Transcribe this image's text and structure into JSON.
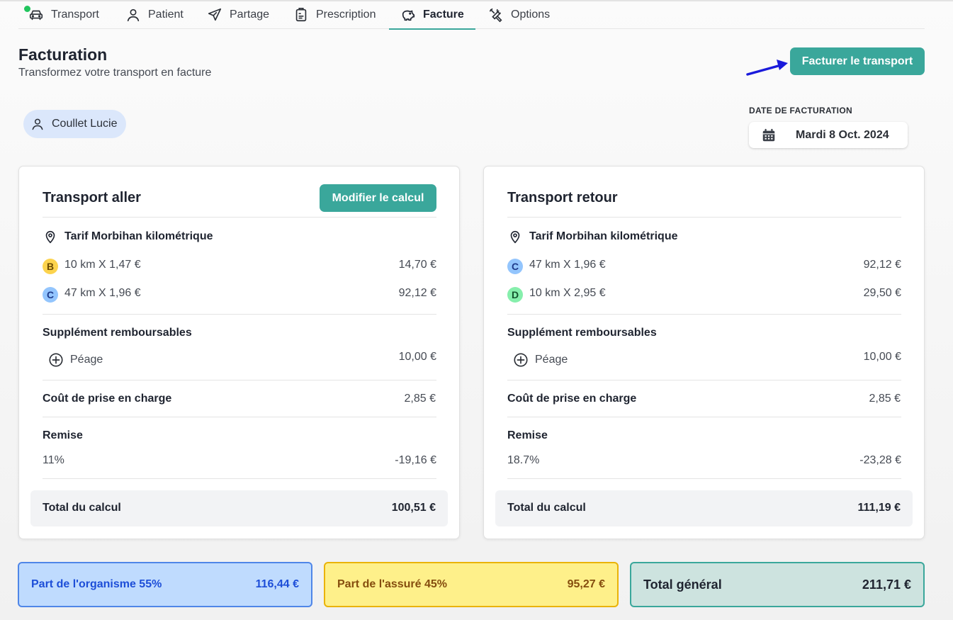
{
  "tabs": [
    {
      "label": "Transport"
    },
    {
      "label": "Patient"
    },
    {
      "label": "Partage"
    },
    {
      "label": "Prescription"
    },
    {
      "label": "Facture"
    },
    {
      "label": "Options"
    }
  ],
  "header": {
    "title": "Facturation",
    "subtitle": "Transformez votre transport en facture",
    "bill_button": "Facturer le transport"
  },
  "patient": {
    "name": "Coullet Lucie"
  },
  "billing_date": {
    "label": "DATE DE FACTURATION",
    "value": "Mardi 8 Oct. 2024"
  },
  "cards": [
    {
      "title": "Transport aller",
      "edit_button": "Modifier le calcul",
      "tarif": "Tarif Morbihan kilométrique",
      "lines": [
        {
          "badge": "B",
          "text": "10 km  X  1,47 €",
          "amount": "14,70 €"
        },
        {
          "badge": "C",
          "text": "47 km  X  1,96 €",
          "amount": "92,12 €"
        }
      ],
      "supplement_title": "Supplément remboursables",
      "supplement_label": "Péage",
      "supplement_amount": "10,00 €",
      "prise_label": "Coût de prise en charge",
      "prise_amount": "2,85 €",
      "remise_title": "Remise",
      "remise_pct": "11%",
      "remise_amount": "-19,16 €",
      "total_label": "Total du calcul",
      "total_amount": "100,51 €"
    },
    {
      "title": "Transport retour",
      "tarif": "Tarif Morbihan kilométrique",
      "lines": [
        {
          "badge": "C",
          "text": "47 km  X  1,96 €",
          "amount": "92,12 €"
        },
        {
          "badge": "D",
          "text": "10 km  X  2,95 €",
          "amount": "29,50 €"
        }
      ],
      "supplement_title": "Supplément remboursables",
      "supplement_label": "Péage",
      "supplement_amount": "10,00 €",
      "prise_label": "Coût de prise en charge",
      "prise_amount": "2,85 €",
      "remise_title": "Remise",
      "remise_pct": "18.7%",
      "remise_amount": "-23,28 €",
      "total_label": "Total du calcul",
      "total_amount": "111,19 €"
    }
  ],
  "summary": {
    "organisme_label": "Part de l'organisme 55%",
    "organisme_amount": "116,44 €",
    "assure_label": "Part de l'assuré 45%",
    "assure_amount": "95,27 €",
    "total_label": "Total général",
    "total_amount": "211,71 €"
  },
  "colors": {
    "accent": "#3aa79b",
    "badge_b": "#fcd34d",
    "badge_c": "#93c5fd",
    "badge_d": "#86efac",
    "organisme_bg": "#bfdbfe",
    "assure_bg": "#fef08a",
    "total_bg": "#cde3df",
    "arrow": "#1a1adb"
  }
}
